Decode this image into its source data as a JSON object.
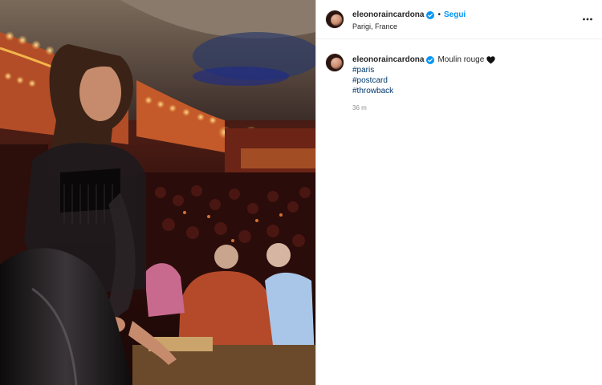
{
  "post": {
    "username": "eleonoraincardona",
    "follow_label": "Segui",
    "separator": "•",
    "location": "Parigi, France",
    "caption_text": "Moulin rouge",
    "caption_emoji": "black-heart-icon",
    "hashtags": [
      "#paris",
      "#postcard",
      "#throwback"
    ],
    "time_ago": "36 m"
  },
  "colors": {
    "link_blue": "#0095f6",
    "hashtag_blue": "#00376b",
    "verified_blue": "#0095f6",
    "muted": "#8e8e8e"
  }
}
